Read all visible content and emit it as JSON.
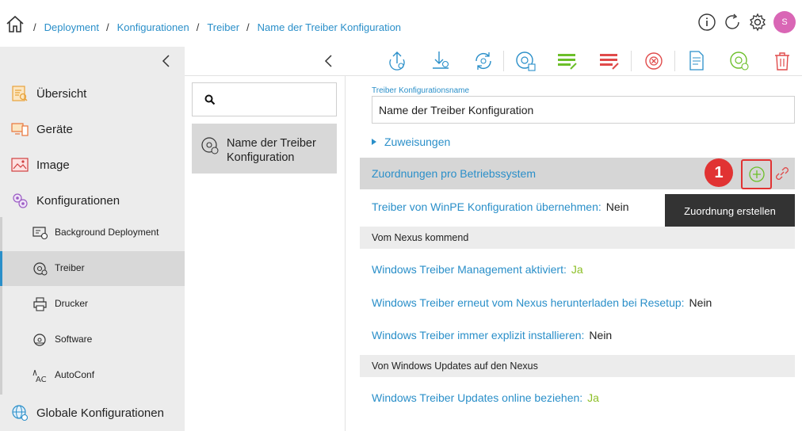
{
  "breadcrumb": [
    "Deployment",
    "Konfigurationen",
    "Treiber",
    "Name der Treiber Konfiguration"
  ],
  "header": {
    "avatar_initial": "S",
    "icons": [
      "info-icon",
      "refresh-icon",
      "gear-icon"
    ]
  },
  "nav": {
    "items": [
      {
        "label": "Übersicht",
        "icon": "overview-icon"
      },
      {
        "label": "Geräte",
        "icon": "devices-icon"
      },
      {
        "label": "Image",
        "icon": "image-icon"
      },
      {
        "label": "Konfigurationen",
        "icon": "configurations-icon"
      },
      {
        "label": "Globale Konfigurationen",
        "icon": "globe-icon"
      }
    ],
    "subitems": [
      {
        "label": "Background Deployment",
        "icon": "background-deployment-icon"
      },
      {
        "label": "Treiber",
        "icon": "driver-icon",
        "active": true
      },
      {
        "label": "Drucker",
        "icon": "printer-icon"
      },
      {
        "label": "Software",
        "icon": "software-icon"
      },
      {
        "label": "AutoConf",
        "icon": "autoconf-icon"
      }
    ]
  },
  "toolbar": {
    "buttons": [
      "upload-icon",
      "download-icon",
      "sync-icon",
      "disk-icon",
      "list-edit-icon",
      "list-delete-icon",
      "cancel-icon",
      "document-icon",
      "disk-settings-icon",
      "trash-icon"
    ]
  },
  "midcol": {
    "search_placeholder": "",
    "items": [
      {
        "label": "Name der Treiber Konfiguration"
      }
    ]
  },
  "content": {
    "name_label": "Treiber Konfigurationsname",
    "name_value": "Name der Treiber Konfiguration",
    "assignments_label": "Zuweisungen",
    "os_section_label": "Zuordnungen pro Betriebssystem",
    "badge": "1",
    "tooltip": "Zuordnung erstellen",
    "winpe_label": "Treiber von WinPE Konfiguration übernehmen:",
    "winpe_value": "Nein",
    "nexus_heading": "Vom Nexus kommend",
    "rows": [
      {
        "label": "Windows Treiber Management aktiviert:",
        "value": "Ja"
      },
      {
        "label": "Windows Treiber erneut vom Nexus herunterladen bei Resetup:",
        "value": "Nein"
      },
      {
        "label": "Windows Treiber immer explizit installieren:",
        "value": "Nein"
      }
    ],
    "updates_heading": "Von Windows Updates auf den Nexus",
    "updates_label": "Windows Treiber Updates online beziehen:",
    "updates_value": "Ja"
  },
  "colors": {
    "accent": "#2a8fc9",
    "yes": "#8cbf26",
    "danger": "#e13333",
    "icon_green": "#6cbf2a",
    "icon_red": "#e04a4a"
  }
}
